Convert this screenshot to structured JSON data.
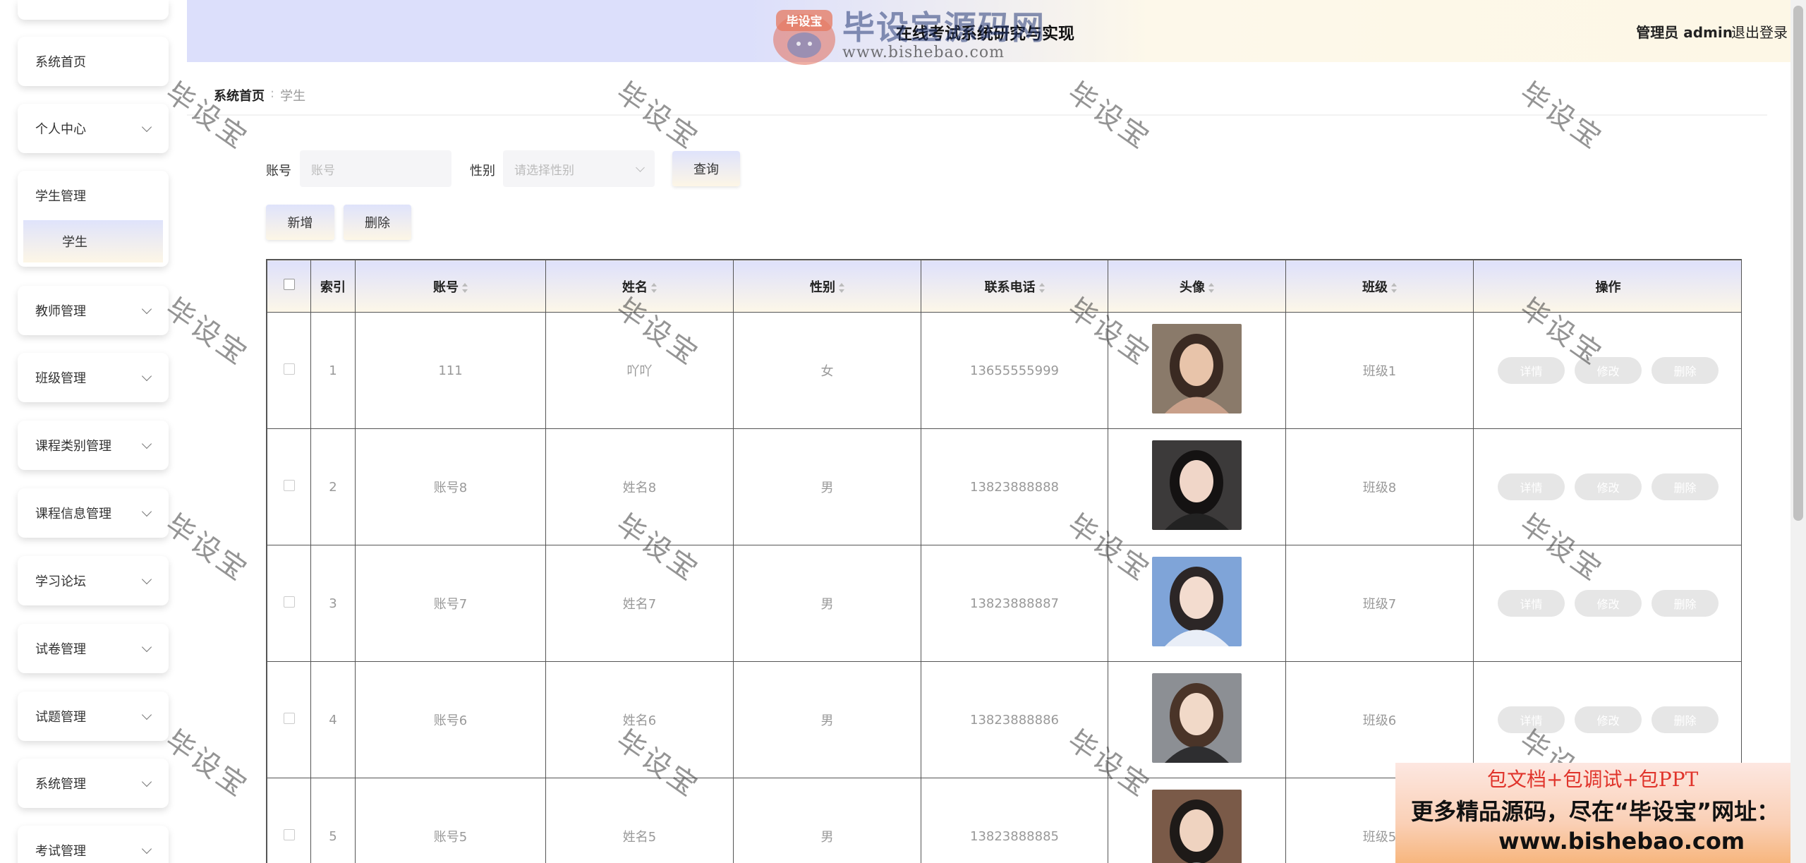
{
  "header": {
    "title": "在线考试系统研究与实现",
    "user_label": "管理员 admin",
    "logout_label": "退出登录"
  },
  "sidebar": {
    "home": "系统首页",
    "personal": "个人中心",
    "students_group": "学生管理",
    "students_sub": "学生",
    "teachers": "教师管理",
    "classes": "班级管理",
    "course_types": "课程类别管理",
    "course_info": "课程信息管理",
    "forum": "学习论坛",
    "papers": "试卷管理",
    "questions": "试题管理",
    "system": "系统管理",
    "exams": "考试管理"
  },
  "breadcrumb": {
    "home": "系统首页",
    "separator": ":",
    "current": "学生"
  },
  "search": {
    "account_label": "账号",
    "account_placeholder": "账号",
    "gender_label": "性别",
    "gender_placeholder": "请选择性别",
    "query_button": "查询"
  },
  "actions": {
    "add": "新增",
    "delete": "删除"
  },
  "table": {
    "headers": {
      "index": "索引",
      "account": "账号",
      "name": "姓名",
      "gender": "性别",
      "phone": "联系电话",
      "avatar": "头像",
      "class": "班级",
      "ops": "操作"
    },
    "op_labels": {
      "detail": "详情",
      "edit": "修改",
      "delete": "删除"
    },
    "rows": [
      {
        "index": "1",
        "account": "111",
        "name": "吖吖",
        "gender": "女",
        "phone": "13655555999",
        "class": "班级1"
      },
      {
        "index": "2",
        "account": "账号8",
        "name": "姓名8",
        "gender": "男",
        "phone": "13823888888",
        "class": "班级8"
      },
      {
        "index": "3",
        "account": "账号7",
        "name": "姓名7",
        "gender": "男",
        "phone": "13823888887",
        "class": "班级7"
      },
      {
        "index": "4",
        "account": "账号6",
        "name": "姓名6",
        "gender": "男",
        "phone": "13823888886",
        "class": "班级6"
      },
      {
        "index": "5",
        "account": "账号5",
        "name": "姓名5",
        "gender": "男",
        "phone": "13823888885",
        "class": "班级5"
      }
    ]
  },
  "watermark": {
    "text": "毕设宝"
  },
  "logo": {
    "badge": "毕设宝",
    "name": "毕设宝源码网",
    "url": "www.bishebao.com"
  },
  "ad": {
    "line1": "包文档+包调试+包PPT",
    "line2": "更多精品源码，尽在“毕设宝”网址：",
    "line3": "www.bishebao.com"
  }
}
